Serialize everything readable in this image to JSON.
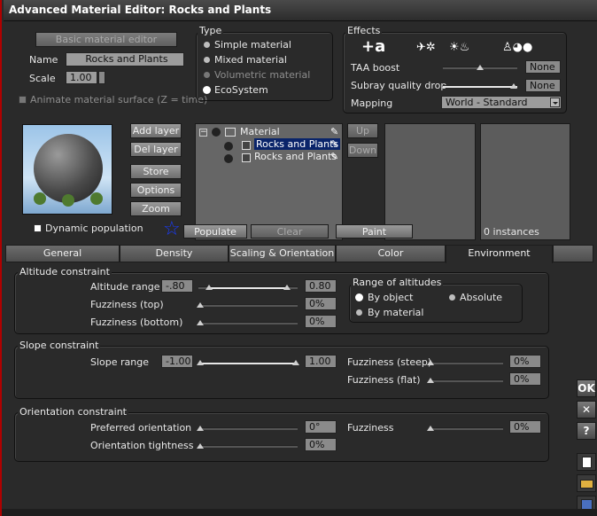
{
  "window": {
    "title": "Advanced Material Editor: Rocks and Plants"
  },
  "basic": {
    "basic_editor_label": "Basic material editor",
    "name_label": "Name",
    "name_value": "Rocks and Plants",
    "scale_label": "Scale",
    "scale_value": "1.00",
    "animate_label": "Animate material surface (Z = time)"
  },
  "type_group": {
    "title": "Type",
    "options": [
      "Simple material",
      "Mixed material",
      "Volumetric material",
      "EcoSystem"
    ],
    "selected": "EcoSystem"
  },
  "effects": {
    "title": "Effects",
    "taa_label": "TAA boost",
    "taa_value": "None",
    "subray_label": "Subray quality drop",
    "subray_value": "None",
    "mapping_label": "Mapping",
    "mapping_value": "World - Standard"
  },
  "layer_buttons": {
    "add": "Add layer",
    "del": "Del layer",
    "store": "Store",
    "options": "Options",
    "zoom": "Zoom",
    "up": "Up",
    "down": "Down"
  },
  "tree": {
    "root": "Material",
    "child1": "Rocks and Plants",
    "child2": "Rocks and Plants"
  },
  "ecosystem_bar": {
    "dynamic_label": "Dynamic population",
    "populate": "Populate",
    "clear": "Clear",
    "paint": "Paint",
    "instances": "0 instances"
  },
  "tabs": [
    "General",
    "Density",
    "Scaling & Orientation",
    "Color",
    "Environment"
  ],
  "active_tab": "Environment",
  "altitude": {
    "title": "Altitude constraint",
    "range_label": "Altitude range",
    "range_min": "-.80",
    "range_max": "0.80",
    "fuzz_top_label": "Fuzziness (top)",
    "fuzz_top_value": "0%",
    "fuzz_bottom_label": "Fuzziness (bottom)",
    "fuzz_bottom_value": "0%",
    "range_group_title": "Range of altitudes",
    "by_object": "By object",
    "absolute": "Absolute",
    "by_material": "By material"
  },
  "slope": {
    "title": "Slope constraint",
    "range_label": "Slope range",
    "range_min": "-1.00",
    "range_max": "1.00",
    "fuzz_steep_label": "Fuzziness (steep)",
    "fuzz_steep_value": "0%",
    "fuzz_flat_label": "Fuzziness (flat)",
    "fuzz_flat_value": "0%"
  },
  "orientation": {
    "title": "Orientation constraint",
    "preferred_label": "Preferred orientation",
    "preferred_value": "0°",
    "tightness_label": "Orientation tightness",
    "tightness_value": "0%",
    "fuzziness_label": "Fuzziness",
    "fuzziness_value": "0%"
  },
  "side_buttons": {
    "ok": "OK",
    "close": "✕",
    "help": "?"
  }
}
